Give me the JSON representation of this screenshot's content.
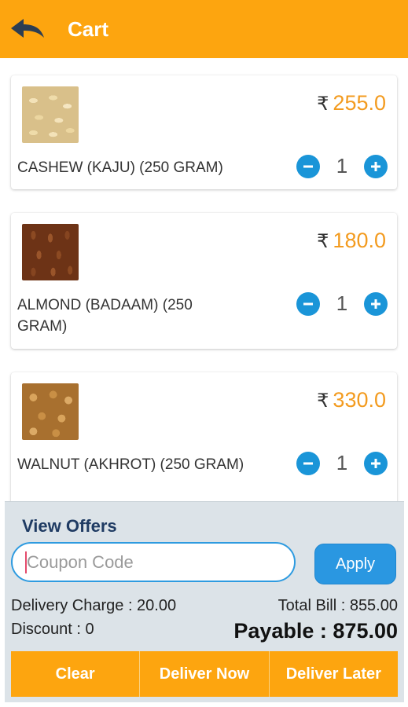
{
  "header": {
    "title": "Cart",
    "back_icon": "back-arrow-icon",
    "color": "#fda50f"
  },
  "cart": {
    "currency_symbol": "₹",
    "items": [
      {
        "name": "CASHEW (KAJU) (250 GRAM)",
        "price": "255.0",
        "quantity": "1",
        "image": "cashew-image"
      },
      {
        "name": "ALMOND (BADAAM) (250 GRAM)",
        "price": "180.0",
        "quantity": "1",
        "image": "almond-image"
      },
      {
        "name": "WALNUT (AKHROT) (250 GRAM)",
        "price": "330.0",
        "quantity": "1",
        "image": "walnut-image"
      }
    ]
  },
  "footer": {
    "view_offers": "View Offers",
    "coupon_placeholder": "Coupon Code",
    "apply_label": "Apply",
    "delivery_charge": "Delivery Charge : 20.00",
    "discount": "Discount : 0",
    "total_bill": "Total Bill : 855.00",
    "payable": "Payable : 875.00"
  },
  "actions": {
    "clear": "Clear",
    "deliver_now": "Deliver Now",
    "deliver_later": "Deliver Later"
  },
  "colors": {
    "accent": "#fda50f",
    "price": "#f39b1f",
    "qty_button": "#1a95d8",
    "apply": "#2a97e1"
  }
}
